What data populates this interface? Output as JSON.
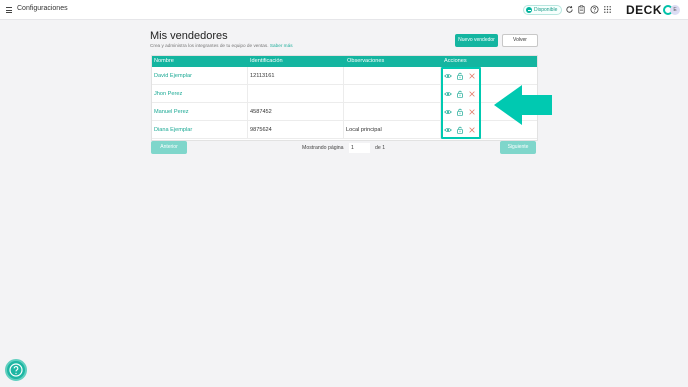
{
  "topbar": {
    "title": "Configuraciones",
    "status_label": "Disponible",
    "logo_text": "DECK",
    "avatar_initial": "E",
    "icons": [
      "menu-icon",
      "refresh-icon",
      "clipboard-icon",
      "help-icon",
      "apps-grid-icon"
    ]
  },
  "page": {
    "title": "Mis vendedores",
    "subtitle": "Crea y administra los integrantes de tu equipo de ventas.",
    "learn_more": "Saber más"
  },
  "buttons": {
    "new_seller": "Nuevo vendedor",
    "back": "Volver"
  },
  "table": {
    "columns": [
      "Nombre",
      "Identificación",
      "Observaciones",
      "Acciones"
    ],
    "rows": [
      {
        "name": "David Ejemplar",
        "id": "12113161",
        "notes": ""
      },
      {
        "name": "Jhon Perez",
        "id": "",
        "notes": ""
      },
      {
        "name": "Manuel Perez",
        "id": "4587452",
        "notes": ""
      },
      {
        "name": "Diana Ejemplar",
        "id": "9875624",
        "notes": "Local principal"
      }
    ],
    "row_actions": [
      "eye-icon",
      "lock-icon",
      "close-icon"
    ]
  },
  "pagination": {
    "prev": "Anterior",
    "next": "Siguiente",
    "label": "Mostrando página",
    "current_page": "1",
    "total": "de 1"
  },
  "colors": {
    "accent": "#14b5a0",
    "highlight": "#00c9b1",
    "background": "#f3f3f5"
  }
}
